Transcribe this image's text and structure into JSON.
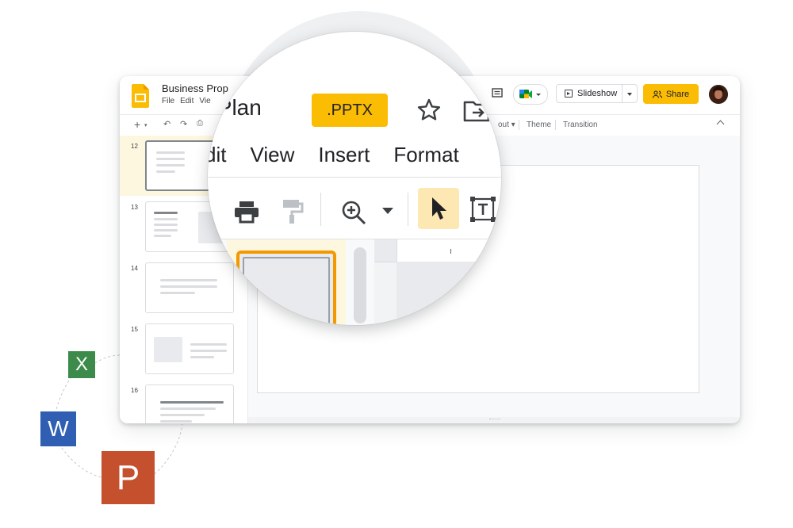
{
  "app": {
    "doc_title": "Business Prop",
    "menu": [
      "File",
      "Edit",
      "Vie"
    ]
  },
  "header": {
    "slideshow_label": "Slideshow",
    "share_label": "Share"
  },
  "toolbar": {
    "layout_label": "out",
    "theme_label": "Theme",
    "transition_label": "Transition"
  },
  "slides_panel": {
    "items": [
      {
        "number": "12",
        "selected": true
      },
      {
        "number": "13",
        "selected": false
      },
      {
        "number": "14",
        "selected": false
      },
      {
        "number": "15",
        "selected": false
      },
      {
        "number": "16",
        "selected": false
      }
    ]
  },
  "magnifier": {
    "title_fragment": "ss Plan",
    "format_badge": ".PPTX",
    "menu": [
      "dit",
      "View",
      "Insert",
      "Format"
    ]
  },
  "file_types": {
    "excel": "X",
    "word": "W",
    "powerpoint": "P"
  },
  "colors": {
    "accent_yellow": "#fbbc04",
    "selection_orange": "#f29900",
    "excel_green": "#3c8b4a",
    "word_blue": "#2f5eb2",
    "powerpoint_red": "#c4502e"
  }
}
